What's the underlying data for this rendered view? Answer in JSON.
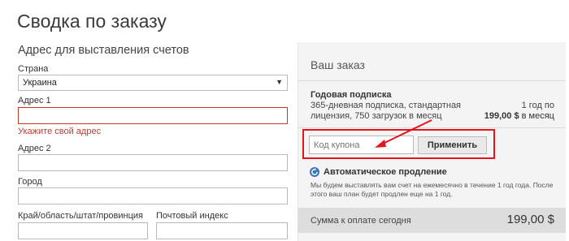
{
  "page_title": "Сводка по заказу",
  "billing": {
    "section_title": "Адрес для выставления счетов",
    "country_label": "Страна",
    "country_value": "Украина",
    "address1_label": "Адрес 1",
    "address1_value": "",
    "address1_error": "Укажите свой адрес",
    "address2_label": "Адрес 2",
    "address2_value": "",
    "city_label": "Город",
    "city_value": "",
    "region_label": "Край/область/штат/провинция",
    "region_value": "",
    "postal_label": "Почтовый индекс",
    "postal_value": ""
  },
  "order": {
    "title": "Ваш заказ",
    "plan_name": "Годовая подписка",
    "plan_description": "365-дневная подписка, стандартная лицензия, 750 загрузок в месяц",
    "plan_period": "1 год по",
    "plan_price": "199,00 $",
    "plan_price_suffix": " в месяц",
    "coupon_placeholder": "Код купона",
    "apply_label": "Применить",
    "auto_renew_title": "Автоматическое продление",
    "auto_renew_text": "Мы будем выставлять вам счет на ежемесячно в течение 1 год года. После этого ваш план будет продлен еще на 1 год.",
    "total_label": "Сумма к оплате сегодня",
    "total_amount": "199,00 $"
  },
  "colors": {
    "error": "#c0392b",
    "highlight_box": "#e5141b",
    "renew_icon": "#3a78b5",
    "panel_bg": "#f4f4f4"
  },
  "icons": {
    "dropdown": "caret-down-icon",
    "auto_renew": "refresh-icon",
    "annotation": "arrow-annotation-icon"
  }
}
